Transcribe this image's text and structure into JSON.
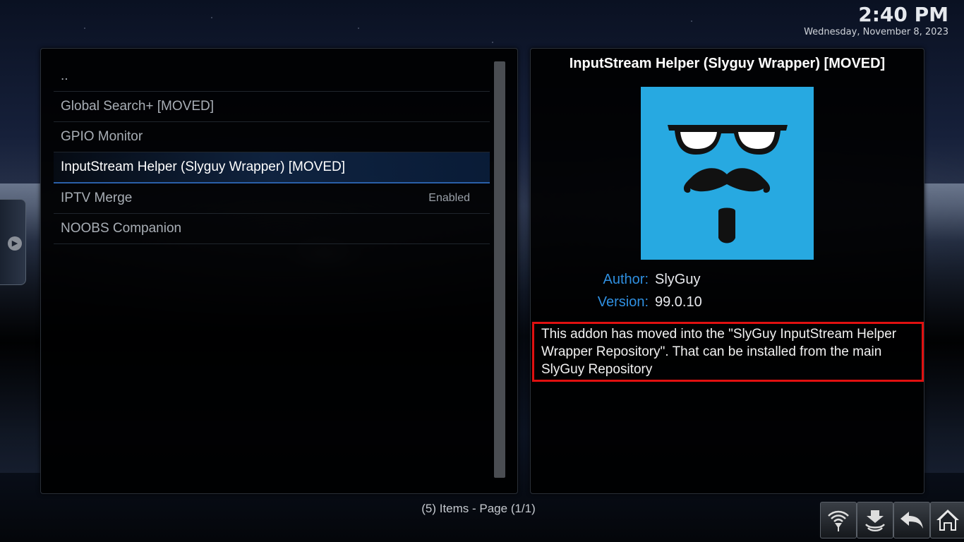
{
  "clock": {
    "time": "2:40 PM",
    "date": "Wednesday, November 8, 2023"
  },
  "list": {
    "items": [
      {
        "label": "..",
        "status": "",
        "selected": false
      },
      {
        "label": "Global Search+ [MOVED]",
        "status": "",
        "selected": false
      },
      {
        "label": "GPIO Monitor",
        "status": "",
        "selected": false
      },
      {
        "label": "InputStream Helper (Slyguy Wrapper) [MOVED]",
        "status": "",
        "selected": true
      },
      {
        "label": "IPTV Merge",
        "status": "Enabled",
        "selected": false
      },
      {
        "label": "NOOBS Companion",
        "status": "",
        "selected": false
      }
    ]
  },
  "info": {
    "title": "InputStream Helper (Slyguy Wrapper) [MOVED]",
    "icon_name": "slyguy-face-icon",
    "icon_bg_color": "#27a9e1",
    "author_label": "Author:",
    "author_value": "SlyGuy",
    "version_label": "Version:",
    "version_value": "99.0.10",
    "description": "This addon has moved into the \"SlyGuy InputStream Helper Wrapper Repository\". That can be installed from the main SlyGuy Repository"
  },
  "footer": {
    "count": "(5) Items - Page (1/1)"
  },
  "buttons": {
    "signal": "signal-icon",
    "eject": "eject-icon",
    "back": "back-icon",
    "home": "home-icon"
  },
  "colors": {
    "accent_label": "#2f8fe0",
    "highlight_border": "#e01010",
    "selection": "#2a5fa8"
  }
}
